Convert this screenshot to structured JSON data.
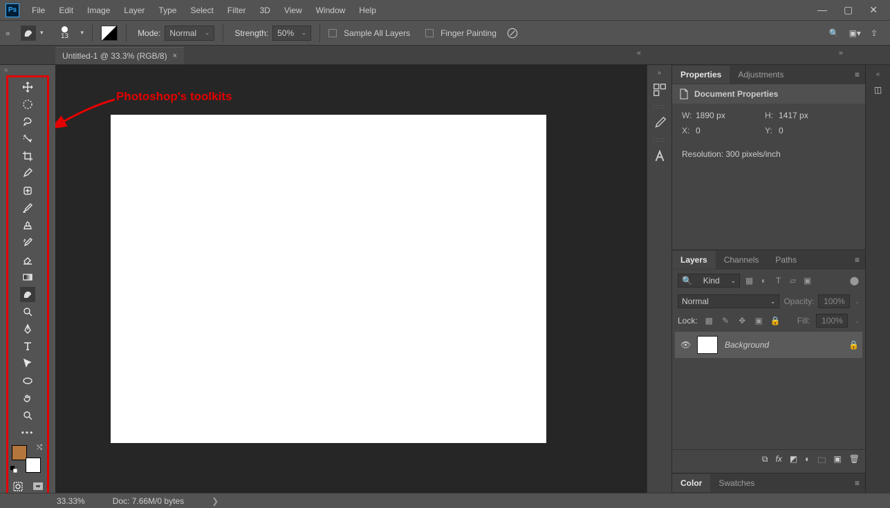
{
  "app_logo": "Ps",
  "menu": [
    "File",
    "Edit",
    "Image",
    "Layer",
    "Type",
    "Select",
    "Filter",
    "3D",
    "View",
    "Window",
    "Help"
  ],
  "options": {
    "brush_size": "13",
    "mode_label": "Mode:",
    "mode_value": "Normal",
    "strength_label": "Strength:",
    "strength_value": "50%",
    "sample_all": "Sample All Layers",
    "finger": "Finger Painting"
  },
  "doc_tab": "Untitled-1 @ 33.3% (RGB/8)",
  "annotation": "Photoshop's toolkits",
  "panels": {
    "properties_tab": "Properties",
    "adjustments_tab": "Adjustments",
    "docprops_title": "Document Properties",
    "w_k": "W:",
    "w_v": "1890 px",
    "h_k": "H:",
    "h_v": "1417 px",
    "x_k": "X:",
    "x_v": "0",
    "y_k": "Y:",
    "y_v": "0",
    "res": "Resolution: 300 pixels/inch",
    "layers_tab": "Layers",
    "channels_tab": "Channels",
    "paths_tab": "Paths",
    "kind": "Kind",
    "blend": "Normal",
    "opacity_lbl": "Opacity:",
    "opacity_val": "100%",
    "lock_lbl": "Lock:",
    "fill_lbl": "Fill:",
    "fill_val": "100%",
    "bg_layer": "Background",
    "color_tab": "Color",
    "swatches_tab": "Swatches"
  },
  "status": {
    "zoom": "33.33%",
    "doc": "Doc: 7.66M/0 bytes"
  },
  "tool_search": "🔍"
}
